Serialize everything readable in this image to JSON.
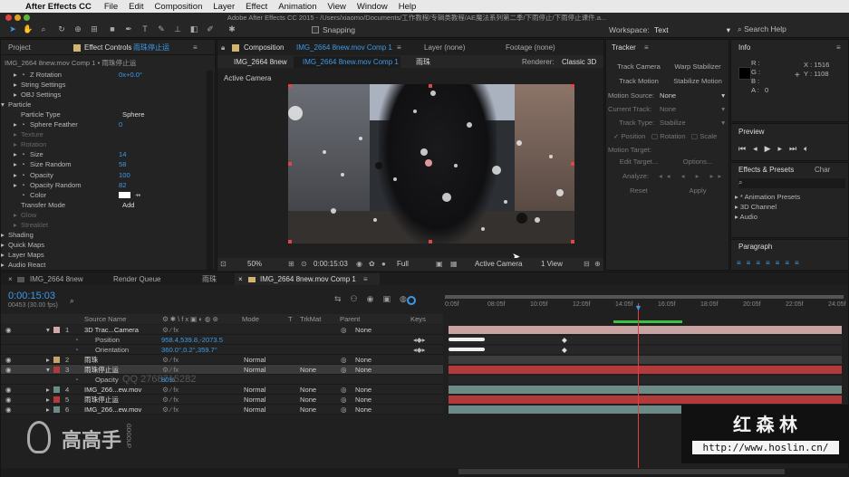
{
  "menubar": {
    "app": "After Effects CC",
    "items": [
      "File",
      "Edit",
      "Composition",
      "Layer",
      "Effect",
      "Animation",
      "View",
      "Window",
      "Help"
    ]
  },
  "window_title": "Adobe After Effects CC 2015 - /Users/xiaomo/Documents/工作教程/专辑类教程/AE魔法系列第二季/下雨停止/下雨停止课件.a...",
  "toolbar": {
    "snapping": "Snapping",
    "workspace_label": "Workspace:",
    "workspace_value": "Text",
    "search_help": "Search Help"
  },
  "left_panel": {
    "tab_project": "Project",
    "tab_effect": "Effect Controls",
    "tab_effect_layer": "雨珠停止运",
    "breadcrumb": "IMG_2664 8new.mov Comp 1 • 雨珠停止运",
    "rows": [
      {
        "label": "Z Rotation",
        "value": "0x+0.0°"
      },
      {
        "label": "String Settings",
        "value": ""
      },
      {
        "label": "OBJ Settings",
        "value": ""
      },
      {
        "label": "Particle",
        "value": ""
      },
      {
        "label": "Particle Type",
        "value": "Sphere"
      },
      {
        "label": "Sphere Feather",
        "value": "0"
      },
      {
        "label": "Texture",
        "value": ""
      },
      {
        "label": "Rotation",
        "value": ""
      },
      {
        "label": "Size",
        "value": "14"
      },
      {
        "label": "Size Random",
        "value": "58"
      },
      {
        "label": "Opacity",
        "value": "100"
      },
      {
        "label": "Opacity Random",
        "value": "82"
      },
      {
        "label": "Color",
        "value": ""
      },
      {
        "label": "Transfer Mode",
        "value": "Add"
      },
      {
        "label": "Glow",
        "value": ""
      },
      {
        "label": "Streaklet",
        "value": ""
      },
      {
        "label": "Shading",
        "value": ""
      },
      {
        "label": "Quick Maps",
        "value": ""
      },
      {
        "label": "Layer Maps",
        "value": ""
      },
      {
        "label": "Audio React",
        "value": ""
      }
    ]
  },
  "comp_panel": {
    "tab_label": "Composition",
    "tab_comp": "IMG_2664 8new.mov Comp 1",
    "tab_layer": "Layer (none)",
    "tab_footage": "Footage (none)",
    "sub_tabs": [
      "IMG_2664 8new",
      "IMG_2664 8new.mov Comp 1",
      "雨珠"
    ],
    "renderer_label": "Renderer:",
    "renderer_value": "Classic 3D",
    "active_camera": "Active Camera",
    "footer": {
      "zoom": "50%",
      "timecode": "0:00:15:03",
      "resolution": "Full",
      "view": "Active Camera",
      "views": "1 View"
    }
  },
  "tracker": {
    "title": "Tracker",
    "track_camera": "Track Camera",
    "warp_stabilizer": "Warp Stabilizer",
    "track_motion": "Track Motion",
    "stabilize_motion": "Stabilize Motion",
    "motion_source_label": "Motion Source:",
    "motion_source_value": "None",
    "current_track_label": "Current Track:",
    "current_track_value": "None",
    "track_type_label": "Track Type:",
    "track_type_value": "Stabilize",
    "position": "Position",
    "rotation": "Rotation",
    "scale": "Scale",
    "motion_target": "Motion Target:",
    "edit_target": "Edit Target...",
    "options": "Options...",
    "analyze": "Analyze:",
    "reset": "Reset",
    "apply": "Apply"
  },
  "info": {
    "title": "Info",
    "r": "R :",
    "g": "G :",
    "b": "B :",
    "a": "A :",
    "a_val": "0",
    "x": "X : 1516",
    "y": "Y : 1108"
  },
  "preview": {
    "title": "Preview"
  },
  "effects_presets": {
    "title": "Effects & Presets",
    "tab2": "Char",
    "items": [
      "* Animation Presets",
      "3D Channel",
      "Audio"
    ]
  },
  "paragraph": {
    "title": "Paragraph"
  },
  "timeline": {
    "tabs": [
      "IMG_2664 8new",
      "Render Queue",
      "雨珠",
      "IMG_2664 8new.mov Comp 1"
    ],
    "timecode": "0:00:15:03",
    "frame_info": "00453 (30.00 fps)",
    "col_source": "Source Name",
    "col_mode": "Mode",
    "col_t": "T",
    "col_trkmat": "TrkMat",
    "col_parent": "Parent",
    "col_keys": "Keys",
    "ruler": [
      "0:05f",
      "08:05f",
      "10:05f",
      "12:05f",
      "14:05f",
      "16:05f",
      "18:05f",
      "20:05f",
      "22:05f",
      "24:05f"
    ],
    "layers": [
      {
        "num": "1",
        "name": "3D Trac...Camera",
        "mode": "",
        "trkmat": "",
        "parent": "None"
      },
      {
        "num": "",
        "name": "Position",
        "value": "958.4,539.8,-2073.5"
      },
      {
        "num": "",
        "name": "Orientation",
        "value": "360.0°,0.2°,359.7°"
      },
      {
        "num": "2",
        "name": "雨珠",
        "mode": "Normal",
        "trkmat": "",
        "parent": "None"
      },
      {
        "num": "3",
        "name": "雨珠停止运",
        "mode": "Normal",
        "trkmat": "None",
        "parent": "None"
      },
      {
        "num": "",
        "name": "Opacity",
        "value": "80%"
      },
      {
        "num": "4",
        "name": "IMG_266...ew.mov",
        "mode": "Normal",
        "trkmat": "None",
        "parent": "None"
      },
      {
        "num": "5",
        "name": "雨珠停止运",
        "mode": "Normal",
        "trkmat": "None",
        "parent": "None"
      },
      {
        "num": "6",
        "name": "IMG_266...ew.mov",
        "mode": "Normal",
        "trkmat": "None",
        "parent": "None"
      }
    ]
  },
  "watermark": {
    "left_brand": "高高手",
    "left_sub": "GOGOUP",
    "right_title": "红 森 林",
    "right_url": "http://www.hoslin.cn/",
    "overlay": "QQ 2768715282"
  },
  "colors": {
    "accent": "#2d8ceb",
    "red_layer": "#b23a3a",
    "teal_layer": "#6b8a88",
    "playhead": "#e04040"
  }
}
